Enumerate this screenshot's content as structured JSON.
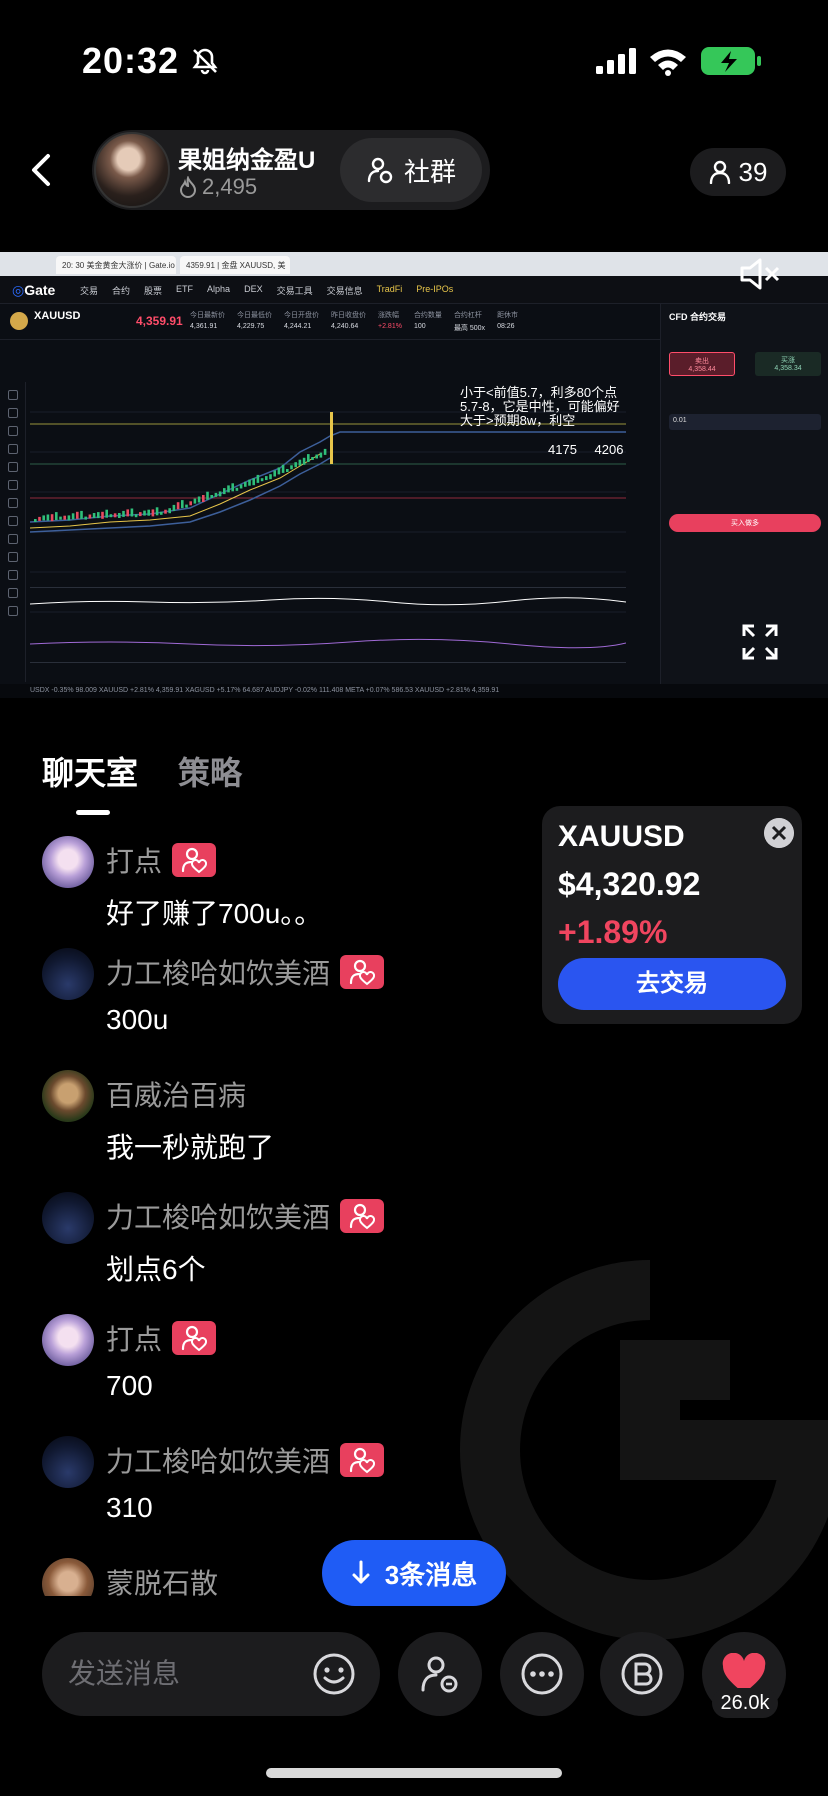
{
  "status_bar": {
    "time": "20:32"
  },
  "header": {
    "host_name": "果姐纳金盈U",
    "host_likes": "2,495",
    "community_label": "社群",
    "viewer_count": "39"
  },
  "stream": {
    "browser_tabs": [
      "20: 30 美金黄金大涨价 | Gate.io",
      "4359.91 | 金盘 XAUUSD, 美"
    ],
    "nav": [
      "交易",
      "合约",
      "股票",
      "ETF",
      "Alpha",
      "DEX",
      "交易工具",
      "交易信息",
      "TradFi",
      "Pre-IPOs"
    ],
    "symbol": "XAUUSD",
    "price": "4,359.91",
    "stats": [
      {
        "label": "今日最新价",
        "value": "4,361.91"
      },
      {
        "label": "今日最低价",
        "value": "4,229.75"
      },
      {
        "label": "今日开盘价",
        "value": "4,244.21"
      },
      {
        "label": "昨日收盘价",
        "value": "4,240.64"
      },
      {
        "label": "涨跌幅",
        "value": "+2.81%"
      },
      {
        "label": "合约数量",
        "value": "100"
      },
      {
        "label": "合约杠杆",
        "value": "最高 500x"
      },
      {
        "label": "距休市",
        "value": "08:26"
      }
    ],
    "panel_title": "CFD 合约交易",
    "sell_label": "卖出",
    "sell_price": "4,358.44",
    "buy_label": "买涨",
    "buy_price": "4,358.34",
    "qty_value": "0.01",
    "buy_btn_label": "买入做多",
    "annotation": "小于<前值5.7，利多80个点\n5.7-8，它是中性，可能偏好\n大于>预期8w，利空",
    "level_1": "4175",
    "level_2": "4206",
    "bottom_ticker": "USDX -0.35% 98.009   XAUUSD +2.81% 4,359.91   XAGUSD +5.17% 64.687   AUDJPY -0.02% 111.408   META +0.07% 586.53   XAUUSD +2.81% 4,359.91"
  },
  "tabs": {
    "chat": "聊天室",
    "strategy": "策略"
  },
  "messages": [
    {
      "name": "打点",
      "text": "好了赚了700u。。",
      "badge": true,
      "avatar": "anime"
    },
    {
      "name": "力工梭哈如饮美酒",
      "text": "300u",
      "badge": true,
      "avatar": "tower"
    },
    {
      "name": "百威治百病",
      "text": "我一秒就跑了",
      "badge": false,
      "avatar": "bear"
    },
    {
      "name": "力工梭哈如饮美酒",
      "text": "划点6个",
      "badge": true,
      "avatar": "tower"
    },
    {
      "name": "打点",
      "text": "700",
      "badge": true,
      "avatar": "anime"
    },
    {
      "name": "力工梭哈如饮美酒",
      "text": "310",
      "badge": true,
      "avatar": "tower"
    },
    {
      "name": "蒙脱石散",
      "text": "",
      "badge": false,
      "avatar": "monk"
    }
  ],
  "asset_card": {
    "symbol": "XAUUSD",
    "price": "$4,320.92",
    "change": "+1.89%",
    "trade_label": "去交易"
  },
  "new_messages_label": "3条消息",
  "input": {
    "placeholder": "发送消息"
  },
  "like_count": "26.0k",
  "colors": {
    "accent_blue": "#2a55f0",
    "up_red": "#f0455f",
    "badge_pink": "#e8405e"
  }
}
